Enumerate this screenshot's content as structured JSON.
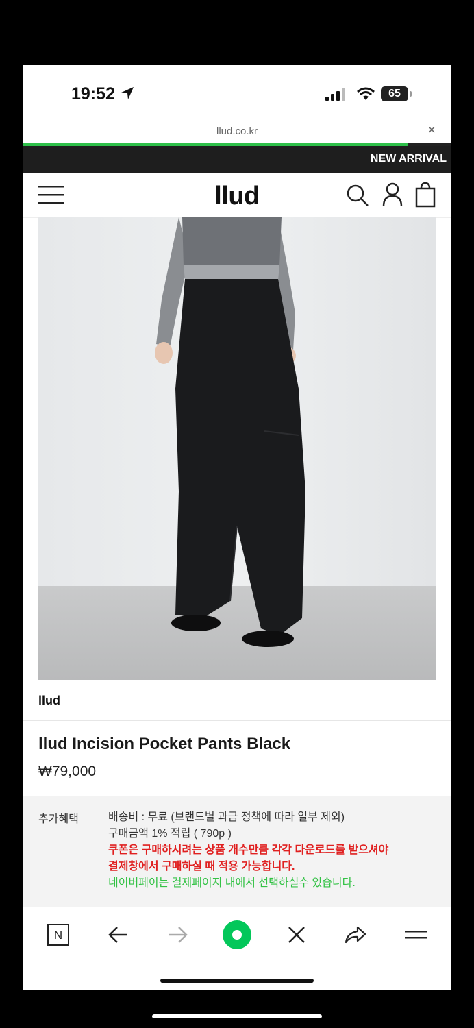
{
  "status_bar": {
    "time": "19:52",
    "battery": "65"
  },
  "browser": {
    "url": "llud.co.kr",
    "close_label": "×",
    "load_progress": 0.9
  },
  "banner": {
    "text": "NEW ARRIVAL"
  },
  "header": {
    "logo": "llud"
  },
  "product": {
    "brand": "llud",
    "name": "llud Incision Pocket Pants Black",
    "price": "₩79,000"
  },
  "benefits": {
    "label": "추가혜택",
    "shipping": "배송비 : 무료 (브랜드별 과금 정책에 따라 일부 제외)",
    "points": "구매금액 1% 적립 ( 790p )",
    "coupon_line1": "쿠폰은 구매하시려는 상품 개수만큼 각각 다운로드를 받으셔야",
    "coupon_line2": "결제창에서 구매하실 때 적용 가능합니다.",
    "naverpay": "네이버페이는 결제페이지 내에서 선택하실수 있습니다."
  },
  "toolbar": {
    "naver_label": "N"
  },
  "colors": {
    "accent_green": "#2ec04a",
    "coupon_red": "#e02020",
    "naver_green": "#03c75a"
  }
}
